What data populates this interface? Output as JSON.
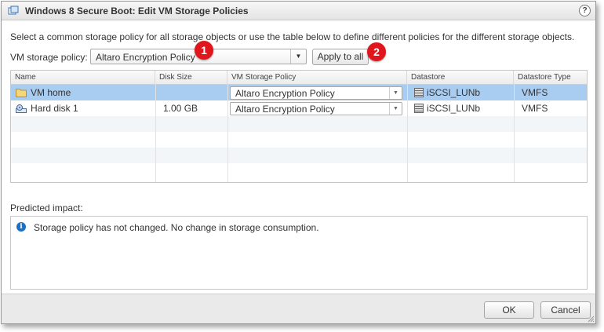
{
  "window": {
    "title": "Windows 8 Secure Boot: Edit VM Storage Policies",
    "help": "?"
  },
  "instruction": "Select a common storage policy for all storage objects or use the table below to define different policies for the different storage objects.",
  "policy": {
    "label": "VM storage policy:",
    "selected": "Altaro Encryption Policy",
    "apply_label": "Apply to all"
  },
  "badges": {
    "one": "1",
    "two": "2"
  },
  "table": {
    "columns": [
      "Name",
      "Disk Size",
      "VM Storage Policy",
      "Datastore",
      "Datastore Type"
    ],
    "rows": [
      {
        "name": "VM home",
        "icon": "folder-icon",
        "disk_size": "",
        "policy": "Altaro Encryption Policy",
        "datastore": "iSCSI_LUNb",
        "datastore_type": "VMFS",
        "selected": true
      },
      {
        "name": "Hard disk 1",
        "icon": "hard-disk-icon",
        "disk_size": "1.00 GB",
        "policy": "Altaro Encryption Policy",
        "datastore": "iSCSI_LUNb",
        "datastore_type": "VMFS",
        "selected": false
      }
    ]
  },
  "impact": {
    "label": "Predicted impact:",
    "message": "Storage policy has not changed. No change in storage consumption."
  },
  "footer": {
    "ok": "OK",
    "cancel": "Cancel"
  },
  "colors": {
    "selected_row": "#a9cdf1",
    "badge": "#e0161c",
    "info": "#1c6fc6"
  }
}
